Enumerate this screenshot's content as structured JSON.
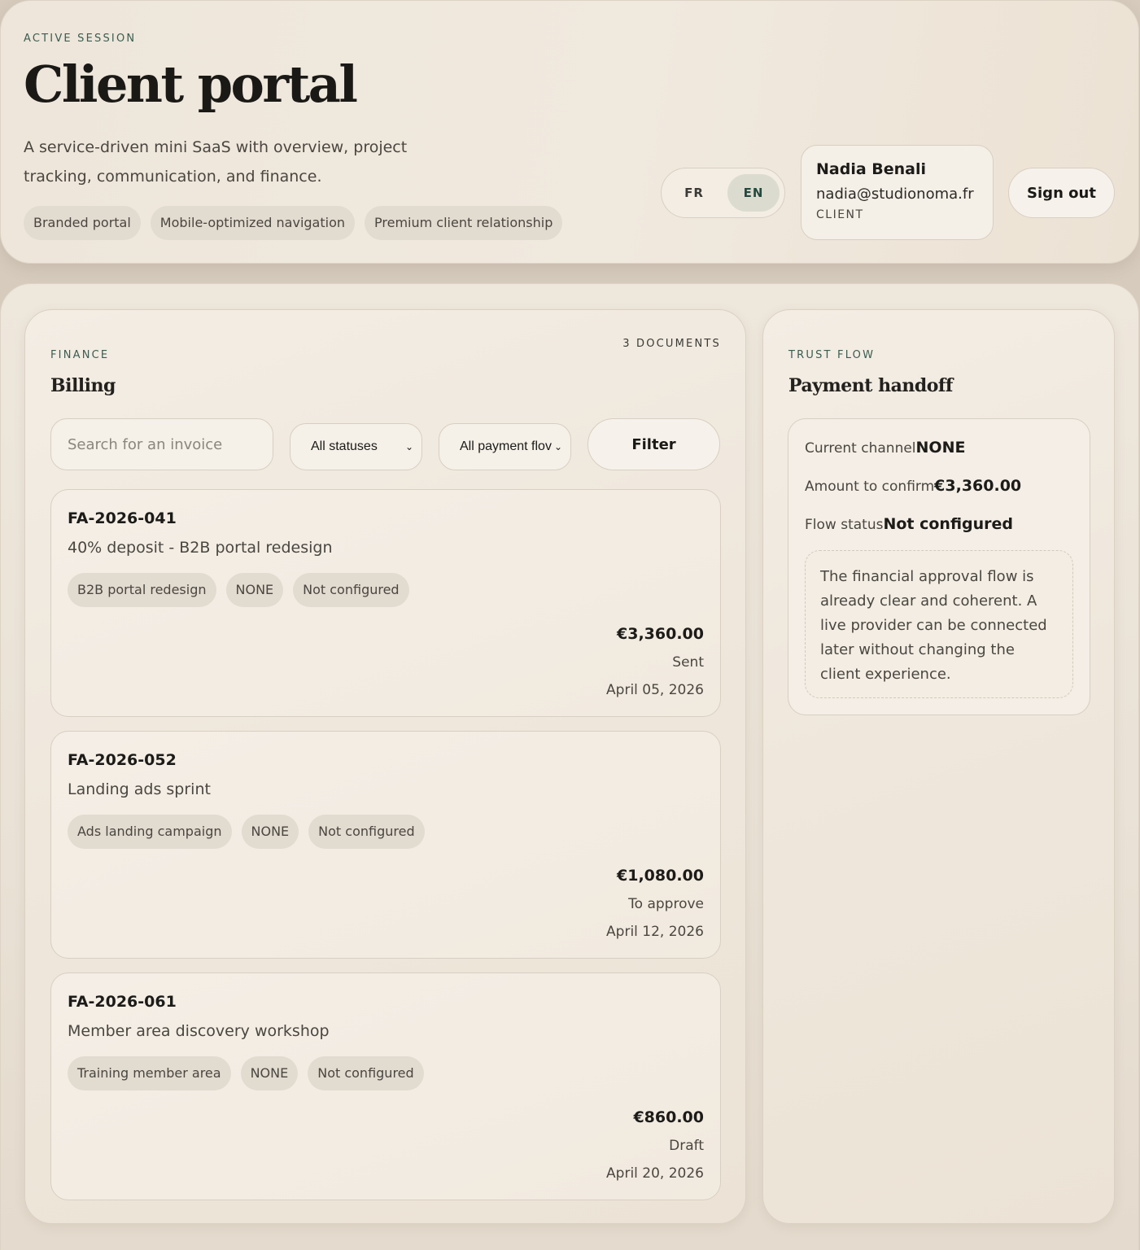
{
  "header": {
    "eyebrow": "ACTIVE SESSION",
    "title": "Client portal",
    "subtitle": "A service-driven mini SaaS with overview, project tracking, communication, and finance.",
    "chips": [
      "Branded portal",
      "Mobile-optimized navigation",
      "Premium client relationship"
    ],
    "languages": [
      {
        "code": "FR",
        "active": false
      },
      {
        "code": "EN",
        "active": true
      }
    ],
    "user": {
      "name": "Nadia Benali",
      "email": "nadia@studionoma.fr",
      "role": "CLIENT"
    },
    "sign_out_label": "Sign out"
  },
  "billing": {
    "eyebrow": "FINANCE",
    "title": "Billing",
    "doc_count": "3 DOCUMENTS",
    "search_placeholder": "Search for an invoice",
    "status_filter": "All statuses",
    "flow_filter": "All payment flov",
    "filter_label": "Filter",
    "invoices": [
      {
        "id": "FA-2026-041",
        "title": "40% deposit - B2B portal redesign",
        "tags": [
          "B2B portal redesign",
          "NONE",
          "Not configured"
        ],
        "amount": "€3,360.00",
        "status": "Sent",
        "date": "April 05, 2026"
      },
      {
        "id": "FA-2026-052",
        "title": "Landing ads sprint",
        "tags": [
          "Ads landing campaign",
          "NONE",
          "Not configured"
        ],
        "amount": "€1,080.00",
        "status": "To approve",
        "date": "April 12, 2026"
      },
      {
        "id": "FA-2026-061",
        "title": "Member area discovery workshop",
        "tags": [
          "Training member area",
          "NONE",
          "Not configured"
        ],
        "amount": "€860.00",
        "status": "Draft",
        "date": "April 20, 2026"
      }
    ]
  },
  "trust": {
    "eyebrow": "TRUST FLOW",
    "title": "Payment handoff",
    "channel_label": "Current channel",
    "channel_value": "NONE",
    "amount_label": "Amount to confirm",
    "amount_value": "€3,360.00",
    "status_label": "Flow status",
    "status_value": "Not configured",
    "note": "The financial approval flow is already clear and coherent. A live provider can be connected later without changing the client experience."
  },
  "colors": {
    "accent": "#3c5c50",
    "background": "#efe7dc",
    "chip": "#e2dbd0"
  }
}
